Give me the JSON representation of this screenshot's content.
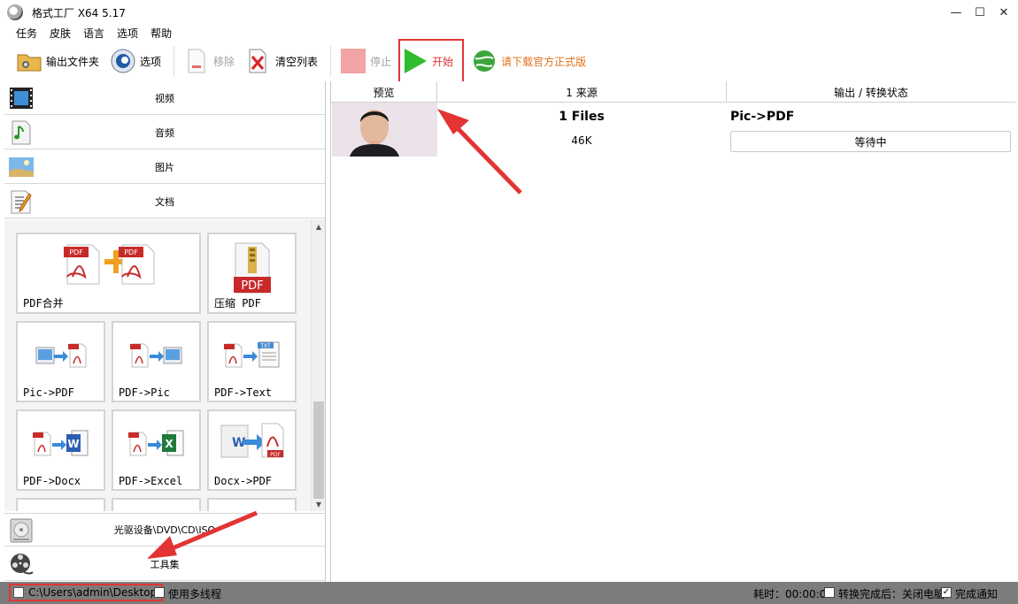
{
  "window": {
    "title": "格式工厂 X64 5.17",
    "controls": [
      "—",
      "☐",
      "✕"
    ]
  },
  "menu": [
    "任务",
    "皮肤",
    "语言",
    "选项",
    "帮助"
  ],
  "toolbar": {
    "output_folder": "输出文件夹",
    "options": "选项",
    "remove": "移除",
    "clear_list": "清空列表",
    "stop": "停止",
    "start": "开始",
    "download_official": "请下载官方正式版"
  },
  "categories": {
    "video": "视频",
    "audio": "音频",
    "image": "图片",
    "document": "文档",
    "optical": "光驱设备\\DVD\\CD\\ISO",
    "tools": "工具集"
  },
  "tiles": {
    "pdf_merge": "PDF合并",
    "compress_pdf": "压缩 PDF",
    "pic_to_pdf": "Pic->PDF",
    "pdf_to_pic": "PDF->Pic",
    "pdf_to_text": "PDF->Text",
    "pdf_to_docx": "PDF->Docx",
    "pdf_to_excel": "PDF->Excel",
    "docx_to_pdf": "Docx->PDF",
    "pdf_badge": "PDF",
    "txt_badge": "TXT",
    "word_badge": "W",
    "excel_badge": "X"
  },
  "scroll": {
    "up": "▲",
    "down": "▼"
  },
  "table": {
    "columns": [
      "预览",
      "1 来源",
      "输出 / 转换状态"
    ],
    "row": {
      "files": "1 Files",
      "size": "46K",
      "conversion": "Pic->PDF",
      "status": "等待中"
    }
  },
  "statusbar": {
    "path": "C:\\Users\\admin\\Desktop",
    "multithread_label": "使用多线程",
    "elapsed": "耗时：00:00:00",
    "after_done": "转换完成后：关闭电脑",
    "notify": "完成通知",
    "multithread_checked": false,
    "after_done_checked": false,
    "notify_checked": true,
    "check_mark": "✓"
  },
  "colors": {
    "accent_red": "#e23434",
    "start_green": "#2ebd2e",
    "download_orange": "#e0701a",
    "statusbar": "#7c7c7c"
  }
}
